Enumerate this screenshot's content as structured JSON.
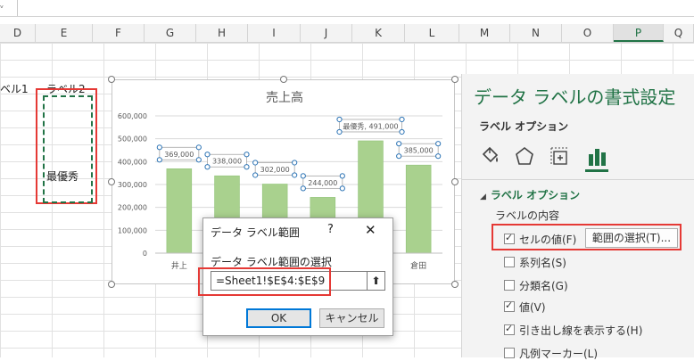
{
  "formula_bar": {
    "corner_glyph": "ᵥ"
  },
  "columns": [
    "D",
    "E",
    "F",
    "G",
    "H",
    "I",
    "J",
    "K",
    "L",
    "M",
    "N",
    "O",
    "P",
    "Q"
  ],
  "active_column": "P",
  "cells": {
    "d_label": "ベル1",
    "e_label": "ラベル2",
    "e_value": "最優秀"
  },
  "chart_data": {
    "type": "bar",
    "title": "売上高",
    "categories": [
      "井上",
      "",
      "",
      "",
      "",
      "倉田"
    ],
    "values": [
      369000,
      338000,
      302000,
      244000,
      491000,
      385000
    ],
    "data_labels": [
      "369,000",
      "338,000",
      "302,000",
      "244,000",
      "最優秀, 491,000",
      "385,000"
    ],
    "ylim": [
      0,
      600000
    ],
    "yticks": [
      "0",
      "100,000",
      "200,000",
      "300,000",
      "400,000",
      "500,000",
      "600,000"
    ],
    "bar_color": "#a9d18e",
    "grid": true
  },
  "pane": {
    "title": "データ ラベルの書式設定",
    "subtitle": "ラベル オプション",
    "icons": [
      "fill-bucket-icon",
      "pentagon-effects-icon",
      "size-properties-icon",
      "bar-chart-options-icon"
    ],
    "section": "ラベル オプション",
    "contents_label": "ラベルの内容",
    "options": [
      {
        "label": "セルの値(F)",
        "checked": true
      },
      {
        "label": "系列名(S)",
        "checked": false
      },
      {
        "label": "分類名(G)",
        "checked": false
      },
      {
        "label": "値(V)",
        "checked": true
      },
      {
        "label": "引き出し線を表示する(H)",
        "checked": true
      },
      {
        "label": "凡例マーカー(L)",
        "checked": false
      }
    ],
    "range_button": "範囲の選択(T)...",
    "accent": "#217346"
  },
  "dialog": {
    "title": "データ ラベル範囲",
    "help": "?",
    "close": "✕",
    "prompt": "データ ラベル範囲の選択",
    "input_value": "=Sheet1!$E$4:$E$9",
    "collapse": "⬆",
    "ok": "OK",
    "cancel": "キャンセル"
  }
}
